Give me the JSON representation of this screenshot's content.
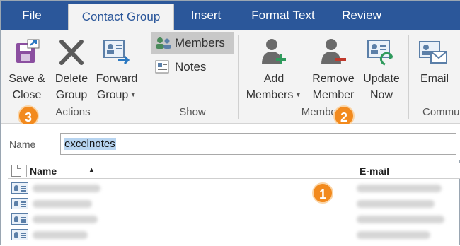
{
  "tabs": [
    {
      "label": "File"
    },
    {
      "label": "Contact Group"
    },
    {
      "label": "Insert"
    },
    {
      "label": "Format Text"
    },
    {
      "label": "Review"
    }
  ],
  "ribbon": {
    "actions": {
      "save_close": {
        "line1": "Save &",
        "line2": "Close"
      },
      "delete_group": {
        "line1": "Delete",
        "line2": "Group"
      },
      "forward_group": {
        "line1": "Forward",
        "line2": "Group"
      },
      "group_label": "Actions"
    },
    "show": {
      "members": "Members",
      "notes": "Notes",
      "group_label": "Show"
    },
    "members": {
      "add_members": {
        "line1": "Add",
        "line2": "Members"
      },
      "remove_member": {
        "line1": "Remove",
        "line2": "Member"
      },
      "update_now": {
        "line1": "Update",
        "line2": "Now"
      },
      "group_label": "Members"
    },
    "communicate": {
      "email": "Email",
      "group_label": "Commu"
    }
  },
  "name_field": {
    "label": "Name",
    "value": "excelnotes"
  },
  "table": {
    "columns": [
      "Name",
      "E-mail"
    ],
    "sort_indicator": "▲"
  },
  "callouts": [
    "1",
    "2",
    "3"
  ],
  "colors": {
    "accent": "#2b579a",
    "callout": "#f28a1e"
  }
}
